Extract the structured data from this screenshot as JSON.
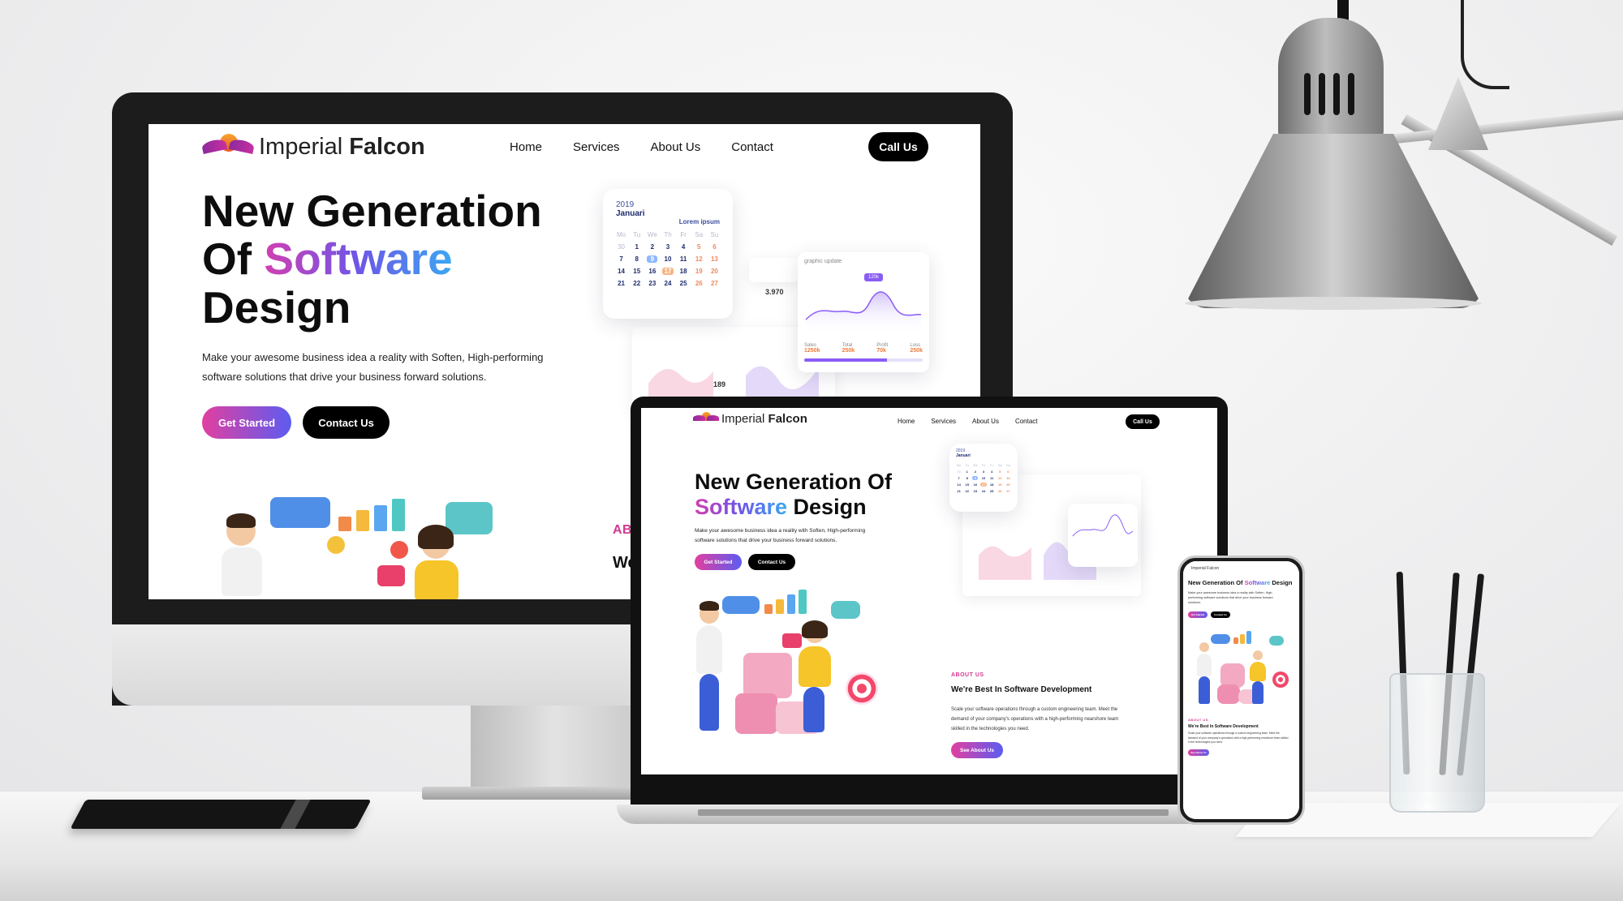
{
  "brand": {
    "name_light": "Imperial",
    "name_bold": "Falcon"
  },
  "nav": {
    "home": "Home",
    "services": "Services",
    "about": "About Us",
    "contact": "Contact",
    "call": "Call Us"
  },
  "hero": {
    "line1": "New Generation",
    "line2_pre": "Of",
    "line2_grad": "Software",
    "line3": "Design",
    "laptop_line1": "New Generation Of",
    "laptop_line2_grad": "Software",
    "laptop_line2_post": "Design",
    "phone_pre": "New Generation Of",
    "phone_grad": "Software",
    "phone_post": "Design",
    "description_l1": "Make your awesome business idea a reality with Soften, High-performing",
    "description_l2": "software solutions that drive your business forward solutions.",
    "get_started": "Get Started",
    "contact_us": "Contact Us"
  },
  "calendar": {
    "year": "2019",
    "month": "Januari",
    "lorem": "Lorem ipsum",
    "day_headers": [
      "Mo",
      "Tu",
      "We",
      "Th",
      "Fr",
      "Sa",
      "Su"
    ],
    "rows": [
      [
        "30",
        "1",
        "2",
        "3",
        "4",
        "5",
        "6"
      ],
      [
        "7",
        "8",
        "9",
        "10",
        "11",
        "12",
        "13"
      ],
      [
        "14",
        "15",
        "16",
        "17",
        "18",
        "19",
        "20"
      ],
      [
        "21",
        "22",
        "23",
        "24",
        "25",
        "26",
        "27"
      ]
    ]
  },
  "graph": {
    "title": "graphic update",
    "badge": "120k",
    "value": "3.970",
    "stats": [
      {
        "label": "Sales",
        "value": "1250k"
      },
      {
        "label": "Total",
        "value": "250k"
      },
      {
        "label": "Profit",
        "value": "70k"
      },
      {
        "label": "Loss",
        "value": "250k"
      }
    ]
  },
  "dashboard": {
    "number": "189"
  },
  "about": {
    "label_monitor": "AB",
    "title_monitor": "We",
    "label": "ABOUT US",
    "title": "We're Best In Software Development",
    "desc_l1": "Scale your software operations through a custom engineering team. Meet the",
    "desc_l2": "demand of your company's operations with a high-performing nearshore team",
    "desc_l3": "skilled in the technologies you need.",
    "button": "See About Us"
  },
  "phone": {
    "brand": "Imperial Falcon",
    "about_label": "ABOUT US",
    "about_title": "We're Best In Software Development"
  },
  "colors": {
    "accent_pink": "#e23fa0",
    "accent_purple": "#6c56e8",
    "accent_blue": "#3aa8f2",
    "button_black": "#000000"
  },
  "icons": [
    "falcon-logo-icon",
    "chat-bubble-icon",
    "megaphone-icon",
    "target-icon",
    "puzzle-icon",
    "bar-chart-icon",
    "heart-icon",
    "user-icon"
  ]
}
